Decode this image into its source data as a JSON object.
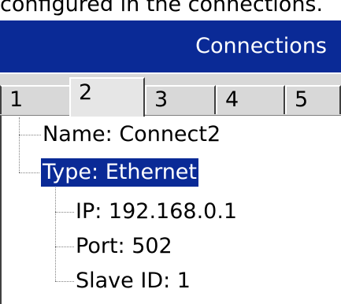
{
  "caption": "configured in the connections.",
  "window": {
    "title": "Connections"
  },
  "tabs": [
    {
      "label": "1",
      "active": false
    },
    {
      "label": "2",
      "active": true
    },
    {
      "label": "3",
      "active": false
    },
    {
      "label": "4",
      "active": false
    },
    {
      "label": "5",
      "active": false
    }
  ],
  "tree": {
    "name": "Name: Connect2",
    "type": "Type: Ethernet",
    "children": {
      "ip": "IP: 192.168.0.1",
      "port": "Port: 502",
      "slave_id": "Slave ID: 1"
    }
  },
  "colors": {
    "titlebar": "#0a2a96",
    "selection": "#0a2a96",
    "tabbar": "#d8d8d8"
  }
}
